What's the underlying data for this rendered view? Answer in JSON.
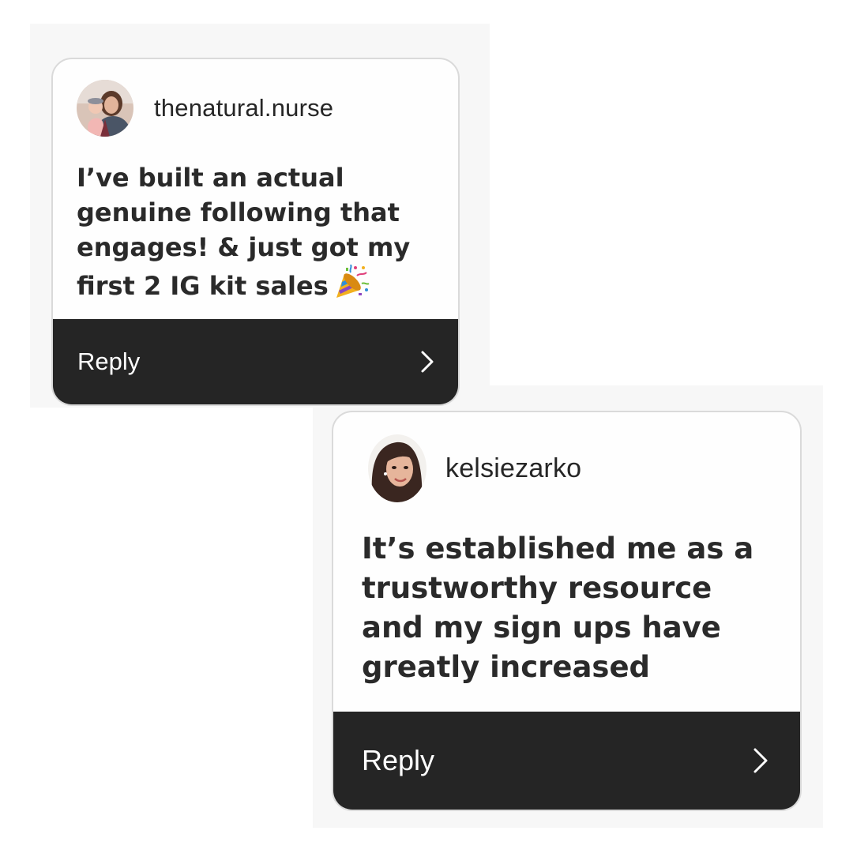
{
  "cards": [
    {
      "username": "thenatural.nurse",
      "message": "I’ve built an actual\ngenuine following that\nengages! & just got my\nfirst 2 IG kit sales",
      "message_icon": "party-popper-icon",
      "reply_label": "Reply",
      "reply_icon": "chevron-right-icon"
    },
    {
      "username": "kelsiezarko",
      "message": "It’s established me as a\ntrustworthy resource\nand my sign ups have\ngreatly increased",
      "reply_label": "Reply",
      "reply_icon": "chevron-right-icon"
    }
  ],
  "colors": {
    "card_background": "#fefefe",
    "card_border": "#dadada",
    "reply_bar": "#252525",
    "reply_text": "#ffffff",
    "text": "#262626"
  }
}
